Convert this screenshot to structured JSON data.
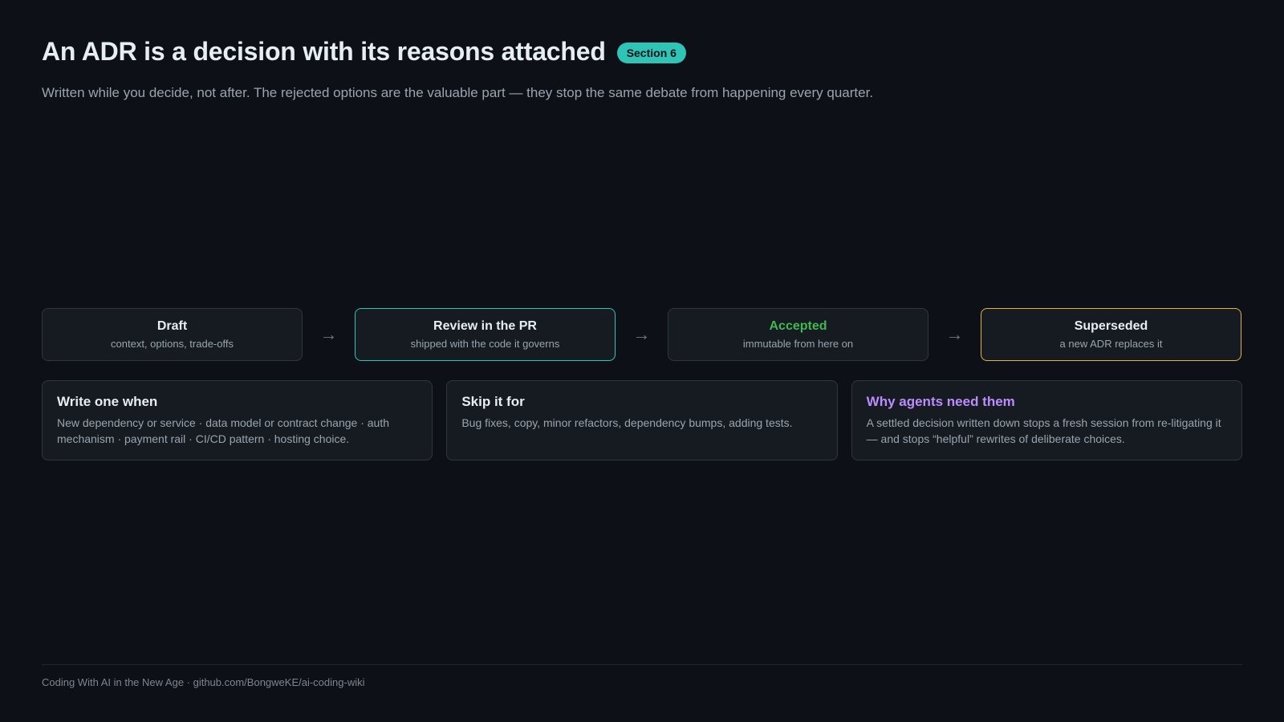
{
  "header": {
    "title": "An ADR is a decision with its reasons attached",
    "badge": "Section 6",
    "subtitle": "Written while you decide, not after. The rejected options are the valuable part — they stop the same debate from happening every quarter."
  },
  "flow": {
    "arrow_glyph": "→",
    "stages": [
      {
        "title": "Draft",
        "subtitle": "context, options, trade-offs"
      },
      {
        "title": "Review in the PR",
        "subtitle": "shipped with the code it governs",
        "accent": "#2ec4b6"
      },
      {
        "title": "Accepted",
        "subtitle": "immutable from here on",
        "accent": "#3fb950"
      },
      {
        "title": "Superseded",
        "subtitle": "a new ADR replaces it",
        "accent": "#e3b341"
      }
    ]
  },
  "cards": [
    {
      "title": "Write one when",
      "body": "New dependency or service · data model or contract change · auth mechanism · payment rail · CI/CD pattern · hosting choice."
    },
    {
      "title": "Skip it for",
      "body": "Bug fixes, copy, minor refactors, dependency bumps, adding tests."
    },
    {
      "title": "Why agents need them",
      "body": "A settled decision written down stops a fresh session from re-litigating it — and stops “helpful” rewrites of deliberate choices.",
      "accent": "#bc8cff"
    }
  ],
  "footer": {
    "text": "Coding With AI in the New Age · github.com/BongweKE/ai-coding-wiki"
  },
  "colors": {
    "background": "#0d1117",
    "panel": "#161b22",
    "border": "#30363d",
    "teal": "#2ec4b6",
    "green": "#3fb950",
    "amber": "#e3b341",
    "purple": "#bc8cff"
  }
}
